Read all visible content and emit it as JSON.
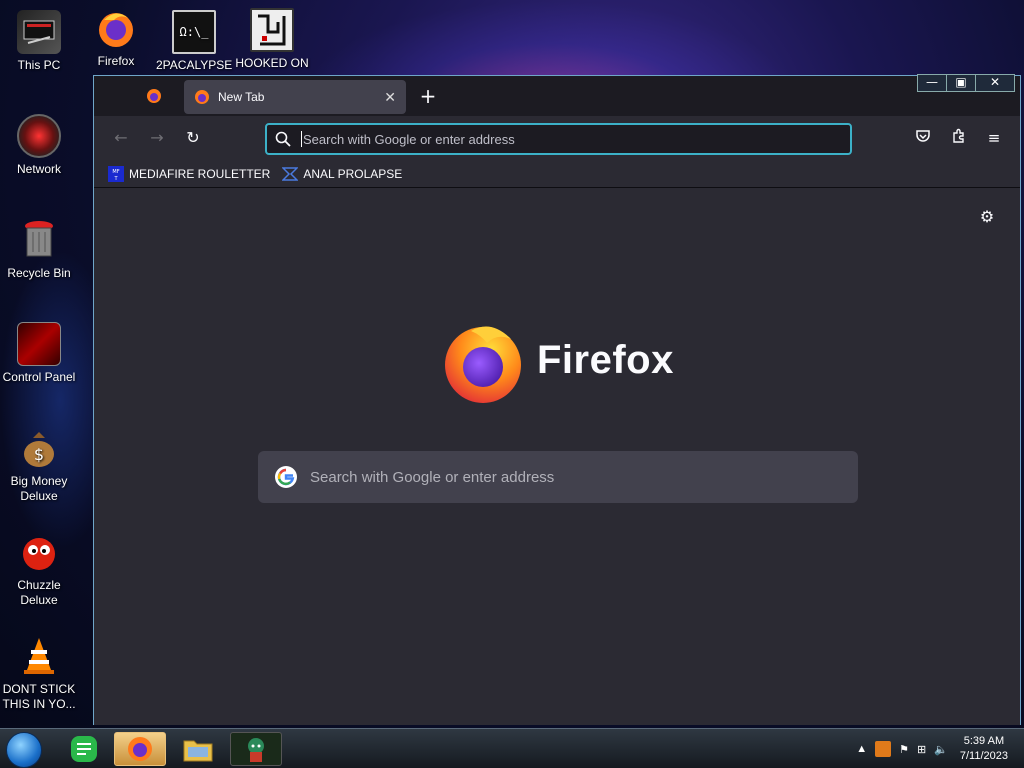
{
  "desktop": {
    "icons": [
      {
        "label": "This PC",
        "icon": "computer-icon"
      },
      {
        "label": "Firefox",
        "icon": "firefox-icon"
      },
      {
        "label": "2PACALYPSE",
        "icon": "terminal-icon"
      },
      {
        "label": "HOOKED ON",
        "icon": "maze-icon"
      },
      {
        "label": "Network",
        "icon": "network-icon"
      },
      {
        "label": "Recycle Bin",
        "icon": "recycle-bin-icon"
      },
      {
        "label": "Control Panel",
        "icon": "control-panel-icon"
      },
      {
        "label": "Big Money Deluxe",
        "icon": "money-bag-icon"
      },
      {
        "label": "Chuzzle Deluxe",
        "icon": "chuzzle-icon"
      },
      {
        "label": "DONT STICK THIS IN YO...",
        "icon": "vlc-cone-icon"
      }
    ]
  },
  "window": {
    "controls": [
      "minimize",
      "maximize",
      "close"
    ]
  },
  "browser": {
    "tab_title": "New Tab",
    "url_placeholder": "Search with Google or enter address",
    "bookmarks": [
      {
        "label": "MEDIAFIRE ROULETTER",
        "icon": "mediafire-icon"
      },
      {
        "label": "ANAL PROLAPSE",
        "icon": "bookmark-site-icon"
      }
    ],
    "brand_name": "Firefox",
    "content_search_placeholder": "Search with Google or enter address"
  },
  "taskbar": {
    "apps": [
      "start-orb",
      "notes-app",
      "firefox",
      "file-explorer",
      "game-character"
    ],
    "clock_time": "5:39 AM",
    "clock_date": "7/11/2023"
  },
  "colors": {
    "accent": "#3cb1c8",
    "toolbar_bg": "#2b2a33",
    "tab_active_bg": "#42414d"
  }
}
